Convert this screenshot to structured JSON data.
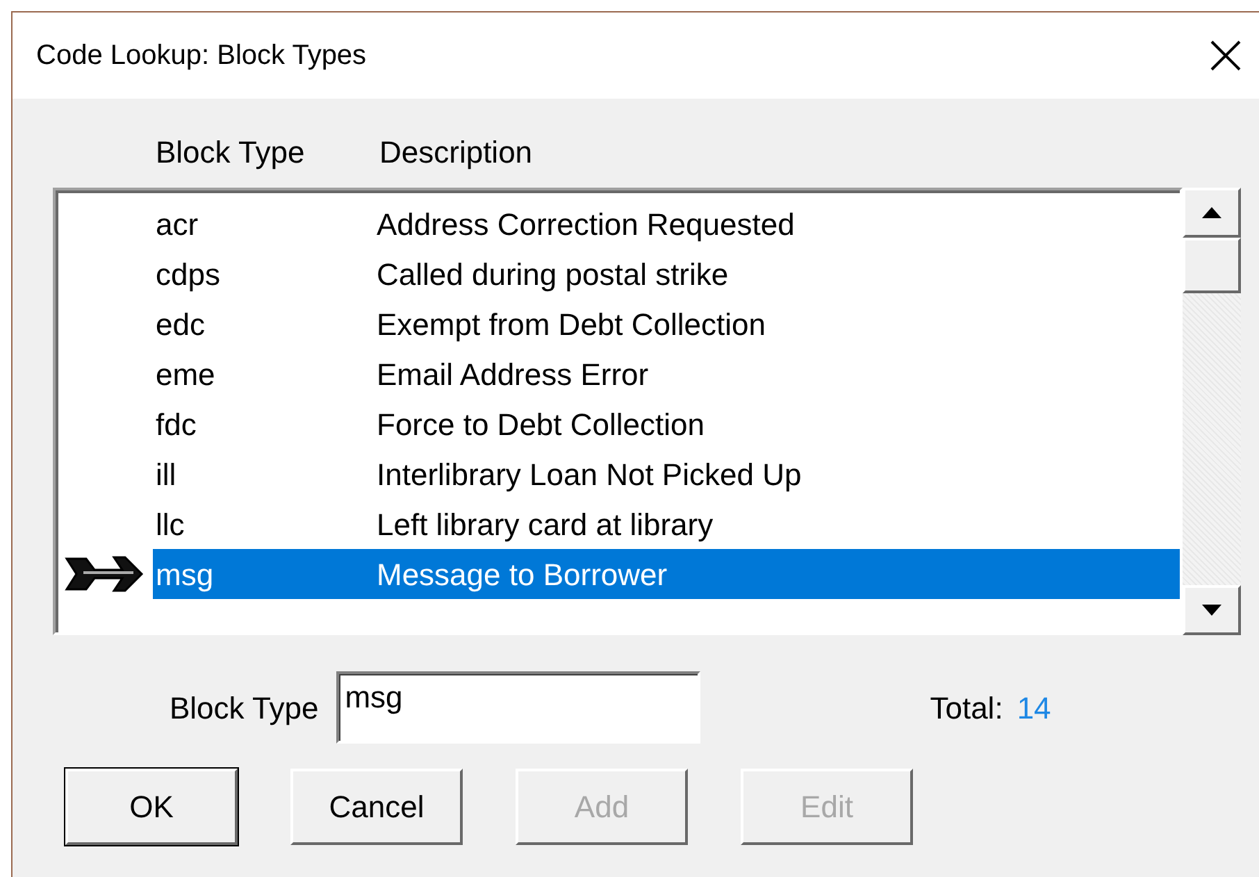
{
  "window": {
    "title": "Code Lookup: Block Types"
  },
  "table": {
    "columns": [
      "Block Type",
      "Description"
    ],
    "rows": [
      {
        "code": "acr",
        "description": "Address Correction Requested",
        "selected": false
      },
      {
        "code": "cdps",
        "description": "Called during postal strike",
        "selected": false
      },
      {
        "code": "edc",
        "description": "Exempt from Debt Collection",
        "selected": false
      },
      {
        "code": "eme",
        "description": "Email Address Error",
        "selected": false
      },
      {
        "code": "fdc",
        "description": "Force to Debt Collection",
        "selected": false
      },
      {
        "code": "ill",
        "description": "Interlibrary Loan Not Picked Up",
        "selected": false
      },
      {
        "code": "llc",
        "description": "Left library card at library",
        "selected": false
      },
      {
        "code": "msg",
        "description": "Message to Borrower",
        "selected": true
      }
    ]
  },
  "field": {
    "label": "Block Type",
    "value": "msg"
  },
  "total": {
    "label": "Total:",
    "value": "14"
  },
  "buttons": [
    {
      "label": "OK",
      "default": true,
      "disabled": false
    },
    {
      "label": "Cancel",
      "default": false,
      "disabled": false
    },
    {
      "label": "Add",
      "default": false,
      "disabled": true
    },
    {
      "label": "Edit",
      "default": false,
      "disabled": true
    }
  ]
}
